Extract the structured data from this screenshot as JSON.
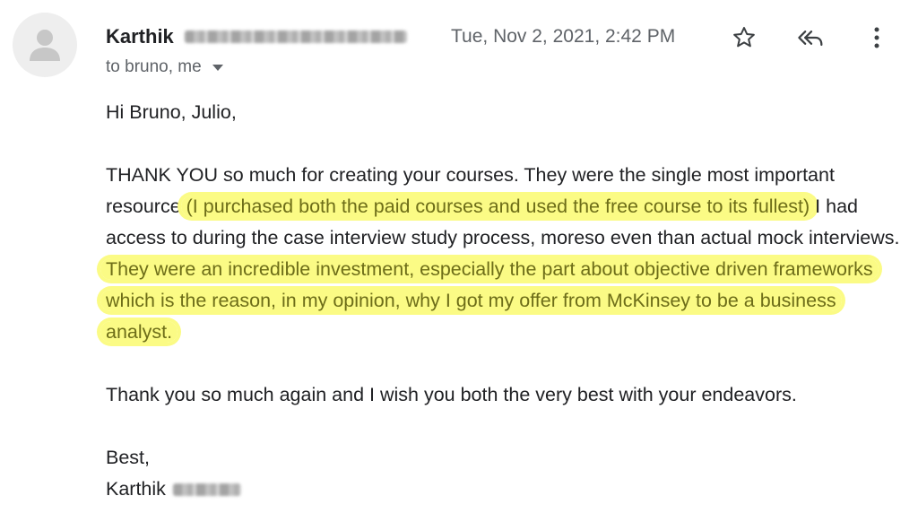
{
  "header": {
    "sender_name": "Karthik",
    "recipients": "to bruno, me",
    "date": "Tue, Nov 2, 2021, 2:42 PM"
  },
  "icons": {
    "avatar": "person-icon",
    "star": "star-icon",
    "reply": "reply-all-icon",
    "more": "more-vert-icon",
    "recipients_toggle": "chevron-down-icon"
  },
  "message": {
    "greeting": "Hi Bruno, Julio,",
    "p1_a": "THANK YOU so much for creating your courses. They were the single most important resource ",
    "p1_hl1": "(I purchased both the paid courses and used the free course to its fullest)",
    "p1_b": " I had access to during the case interview study process, moreso even than actual mock interviews. ",
    "p1_hl2": "They were an incredible investment, especially the part about objective driven frameworks which is the reason, in my opinion, why I got my offer from McKinsey to be a business analyst.",
    "p2": "Thank you so much again and I wish you both the very best with your endeavors.",
    "signoff": "Best,",
    "signature_name": "Karthik"
  },
  "colors": {
    "highlight": "#fbfb85",
    "highlight_text": "#6d6d18",
    "text": "#202124",
    "secondary_text": "#5f6368"
  }
}
